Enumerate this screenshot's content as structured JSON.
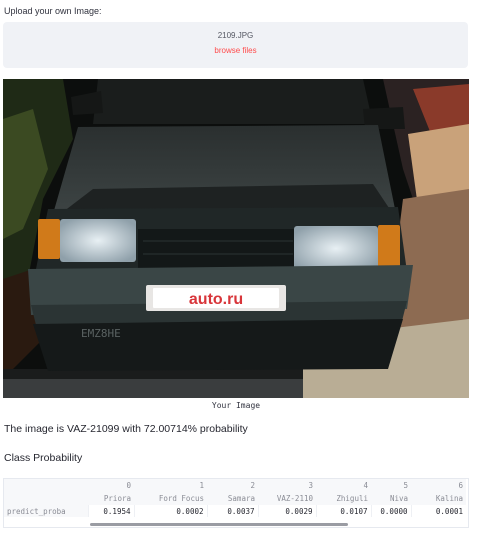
{
  "uploader": {
    "label": "Upload your own Image:",
    "filename": "2109.JPG",
    "browse_label": "browse files"
  },
  "image": {
    "caption": "Your Image",
    "plate_text": "auto.ru"
  },
  "result": {
    "text": "The image is VAZ-21099 with 72.00714% probability"
  },
  "class_probability": {
    "heading": "Class Probability",
    "column_indices": [
      "0",
      "1",
      "2",
      "3",
      "4",
      "5",
      "6"
    ],
    "class_names": [
      "Priora",
      "Ford Focus",
      "Samara",
      "VAZ-2110",
      "Zhiguli",
      "Niva",
      "Kalina"
    ],
    "row_label": "predict_proba",
    "values": [
      "0.1954",
      "0.0002",
      "0.0037",
      "0.0029",
      "0.0107",
      "0.0000",
      "0.0001"
    ]
  },
  "colors": {
    "accent": "#ff4b4b",
    "dropzone_bg": "#f0f2f6",
    "text": "#262730"
  }
}
